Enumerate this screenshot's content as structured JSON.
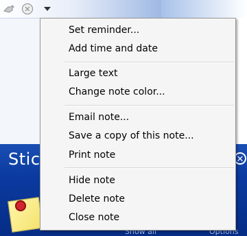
{
  "background": {
    "app_title": "Stic",
    "footer_show_all": "Show all",
    "footer_options": "Options"
  },
  "colors": {
    "menu_bg": "#f5f5f5",
    "menu_border": "#979797",
    "desktop_blue": "#0b3aa0"
  },
  "toolbar": {
    "icons": [
      "pin-icon",
      "close-circle-icon",
      "dropdown-arrow-icon"
    ]
  },
  "menu": {
    "group1": {
      "set_reminder": "Set reminder...",
      "add_time_date": "Add time and date"
    },
    "group2": {
      "large_text": "Large text",
      "change_color": "Change note color..."
    },
    "group3": {
      "email_note": "Email note...",
      "save_copy": "Save a copy of this note...",
      "print_note": "Print note"
    },
    "group4": {
      "hide_note": "Hide note",
      "delete_note": "Delete note",
      "close_note": "Close note"
    }
  }
}
